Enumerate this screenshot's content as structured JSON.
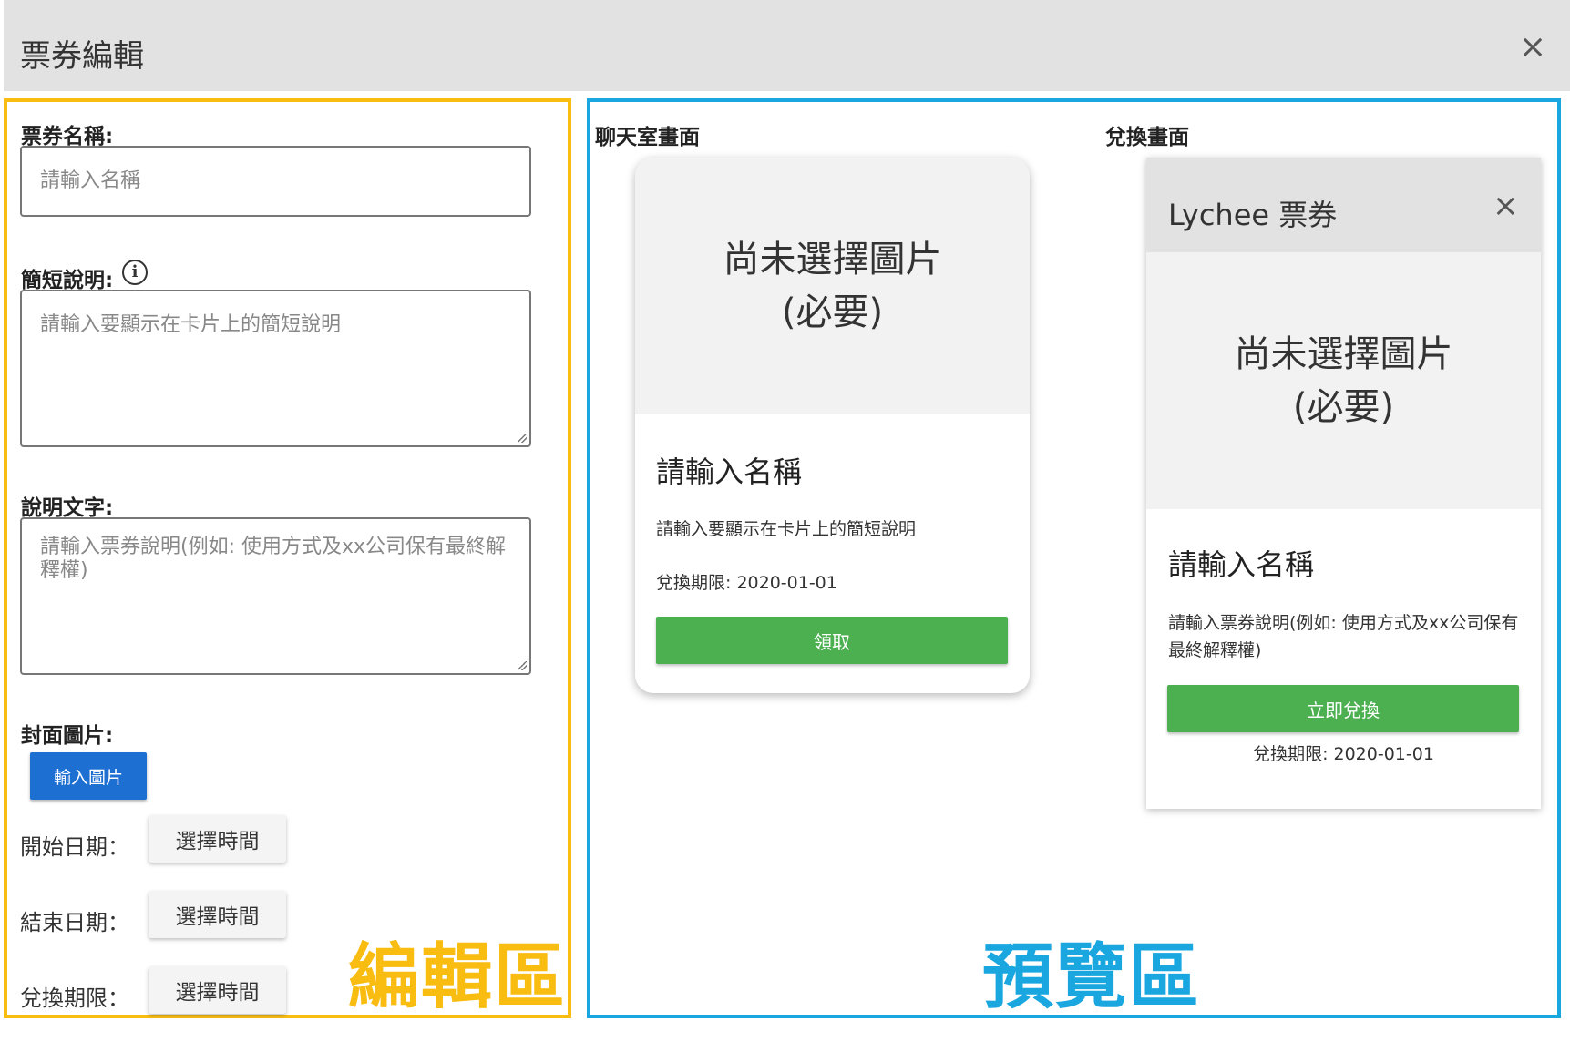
{
  "dialog": {
    "title": "票券編輯",
    "close_icon": "×"
  },
  "editor": {
    "zone_label": "編輯區",
    "zone_color": "#f9bd12",
    "name_label": "票券名稱:",
    "name_placeholder": "請輸入名稱",
    "short_desc_label": "簡短說明:",
    "short_desc_info_icon": "i",
    "short_desc_placeholder": "請輸入要顯示在卡片上的簡短說明",
    "desc_label": "說明文字:",
    "desc_placeholder": "請輸入票券說明(例如: 使用方式及xx公司保有最終解釋權)",
    "cover_label": "封面圖片:",
    "upload_button": "輸入圖片",
    "start_date_label": "開始日期：",
    "end_date_label": "結束日期：",
    "expiry_label": "兌換期限：",
    "select_time_button": "選擇時間"
  },
  "preview": {
    "zone_label": "預覽區",
    "zone_color": "#1aa7e0",
    "chat_title": "聊天室畫面",
    "redeem_title": "兌換畫面",
    "chat_card": {
      "image_placeholder_line1": "尚未選擇圖片",
      "image_placeholder_line2": "(必要)",
      "name": "請輸入名稱",
      "short_desc": "請輸入要顯示在卡片上的簡短說明",
      "expiry": "兌換期限: 2020-01-01",
      "claim_button": "領取"
    },
    "redeem_panel": {
      "title": "Lychee 票券",
      "close_icon": "×",
      "image_placeholder_line1": "尚未選擇圖片",
      "image_placeholder_line2": "(必要)",
      "name": "請輸入名稱",
      "description": "請輸入票券說明(例如: 使用方式及xx公司保有最終解釋權)",
      "redeem_button": "立即兌換",
      "expiry": "兌換期限: 2020-01-01"
    }
  }
}
